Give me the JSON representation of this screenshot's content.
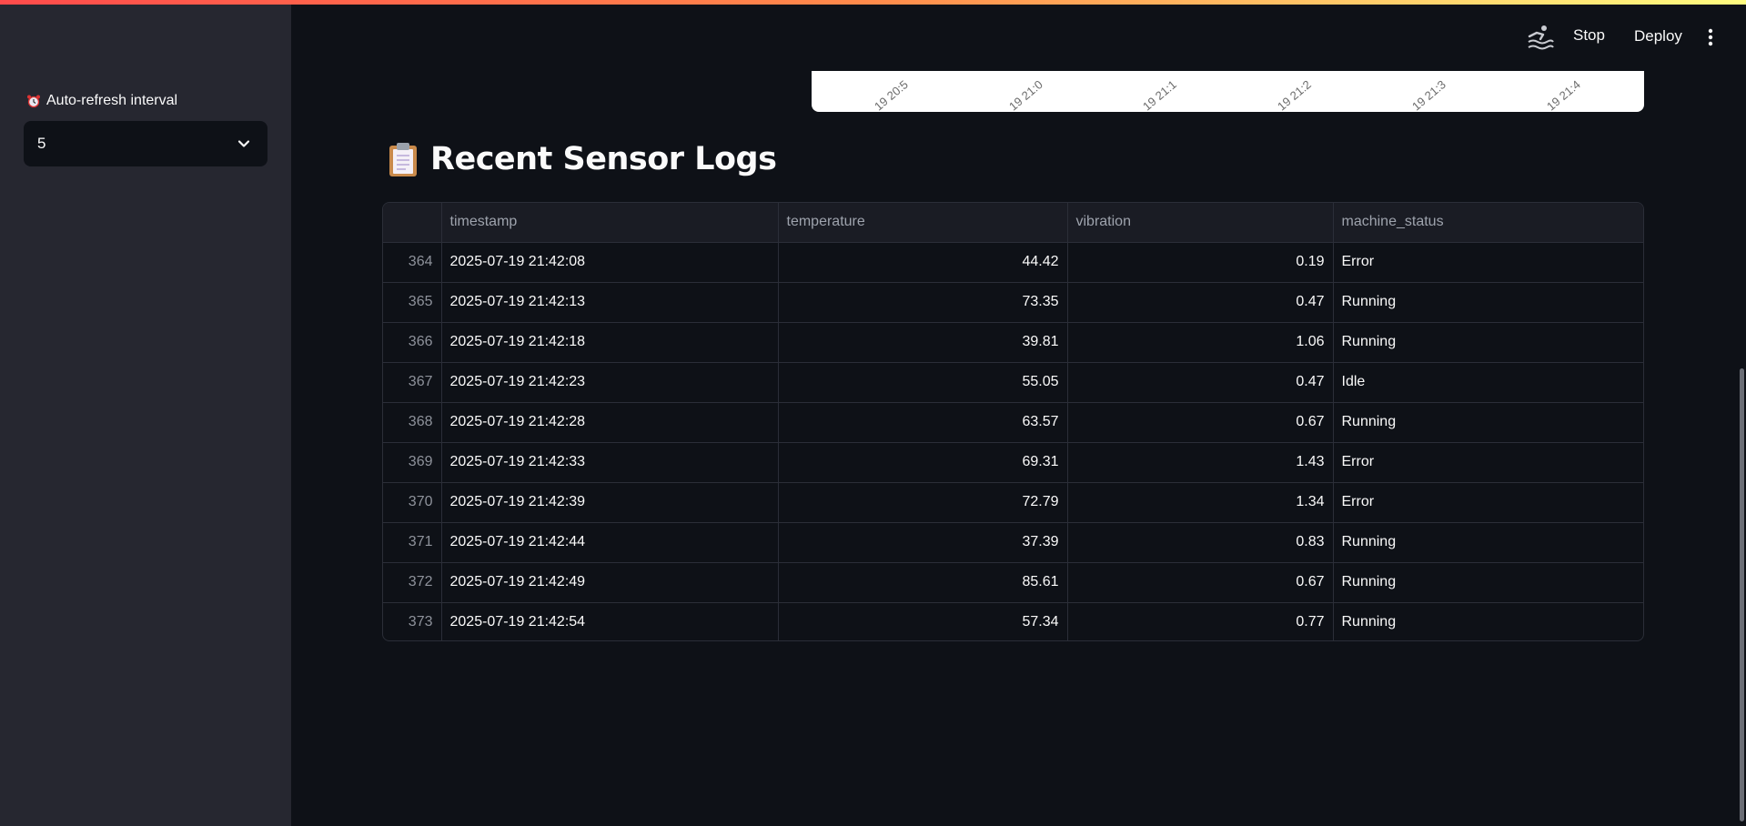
{
  "sidebar": {
    "refresh_label": "Auto-refresh interval",
    "refresh_value": "5"
  },
  "header": {
    "stop_label": "Stop",
    "deploy_label": "Deploy"
  },
  "chart_ticks": [
    "19 20:5",
    "19 21:0",
    "19 21:1",
    "19 21:2",
    "19 21:3",
    "19 21:4"
  ],
  "section": {
    "title": "Recent Sensor Logs"
  },
  "table": {
    "columns": [
      "",
      "timestamp",
      "temperature",
      "vibration",
      "machine_status"
    ],
    "rows": [
      {
        "index": "364",
        "timestamp": "2025-07-19 21:42:08",
        "temperature": "44.42",
        "vibration": "0.19",
        "machine_status": "Error"
      },
      {
        "index": "365",
        "timestamp": "2025-07-19 21:42:13",
        "temperature": "73.35",
        "vibration": "0.47",
        "machine_status": "Running"
      },
      {
        "index": "366",
        "timestamp": "2025-07-19 21:42:18",
        "temperature": "39.81",
        "vibration": "1.06",
        "machine_status": "Running"
      },
      {
        "index": "367",
        "timestamp": "2025-07-19 21:42:23",
        "temperature": "55.05",
        "vibration": "0.47",
        "machine_status": "Idle"
      },
      {
        "index": "368",
        "timestamp": "2025-07-19 21:42:28",
        "temperature": "63.57",
        "vibration": "0.67",
        "machine_status": "Running"
      },
      {
        "index": "369",
        "timestamp": "2025-07-19 21:42:33",
        "temperature": "69.31",
        "vibration": "1.43",
        "machine_status": "Error"
      },
      {
        "index": "370",
        "timestamp": "2025-07-19 21:42:39",
        "temperature": "72.79",
        "vibration": "1.34",
        "machine_status": "Error"
      },
      {
        "index": "371",
        "timestamp": "2025-07-19 21:42:44",
        "temperature": "37.39",
        "vibration": "0.83",
        "machine_status": "Running"
      },
      {
        "index": "372",
        "timestamp": "2025-07-19 21:42:49",
        "temperature": "85.61",
        "vibration": "0.67",
        "machine_status": "Running"
      },
      {
        "index": "373",
        "timestamp": "2025-07-19 21:42:54",
        "temperature": "57.34",
        "vibration": "0.77",
        "machine_status": "Running"
      }
    ]
  },
  "colors": {
    "background": "#0e1117",
    "sidebar": "#262730",
    "accent_start": "#ff4b4b",
    "accent_end": "#fffd80"
  },
  "icons": {
    "alarm": "alarm-clock-icon",
    "chevron": "chevron-down-icon",
    "running": "running-man-icon",
    "menu": "kebab-menu-icon",
    "clipboard": "clipboard-icon"
  }
}
